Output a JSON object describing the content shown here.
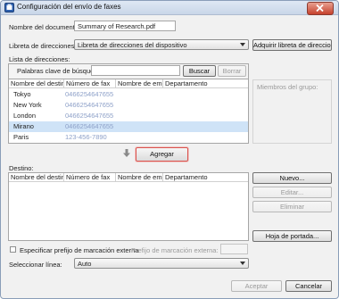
{
  "window": {
    "title": "Configuración del envío de faxes",
    "close_symbol": "✕"
  },
  "document": {
    "label": "Nombre del documento:",
    "value": "Summary of Research.pdf"
  },
  "address_book": {
    "label": "Libreta de direcciones:",
    "selected": "Libreta de direcciones del dispositivo",
    "add_button": "Adquirir libreta de direcciones"
  },
  "address_list": {
    "label": "Lista de direcciones:",
    "search_label": "Palabras clave de búsqueda",
    "search_value": "",
    "search_button": "Buscar",
    "clear_button": "Borrar",
    "columns": [
      "Nombre del destino",
      "Número de fax",
      "Nombre de em...",
      "Departamento"
    ],
    "rows": [
      {
        "name": "Tokyo",
        "fax": "0466254647655"
      },
      {
        "name": "New York",
        "fax": "0466254647655"
      },
      {
        "name": "London",
        "fax": "0466254647655"
      },
      {
        "name": "Mirano",
        "fax": "0466254647655",
        "selected": true
      },
      {
        "name": "Paris",
        "fax": "123-456-7890"
      }
    ],
    "group_members_label": "Miembros del grupo:"
  },
  "add_button": "Agregar",
  "destination": {
    "label": "Destino:",
    "columns": [
      "Nombre del destino",
      "Número de fax",
      "Nombre de em...",
      "Departamento"
    ],
    "new_button": "Nuevo...",
    "edit_button": "Editar...",
    "delete_button": "Eliminar",
    "cover_button": "Hoja de portada..."
  },
  "prefix": {
    "checkbox_label": "Especificar prefijo de marcación externa",
    "field_label": "Prefijo de marcación externa:",
    "value": ""
  },
  "line": {
    "label": "Seleccionar línea:",
    "selected": "Auto"
  },
  "footer": {
    "accept_button": "Aceptar",
    "cancel_button": "Cancelar"
  },
  "colors": {
    "selected_row": "#cfe3f7",
    "title_bar": "#c9d6e8",
    "focus_ring": "#d9534f"
  },
  "icons": {
    "app": "fax-app-icon",
    "arrow": "down-arrow-icon"
  }
}
